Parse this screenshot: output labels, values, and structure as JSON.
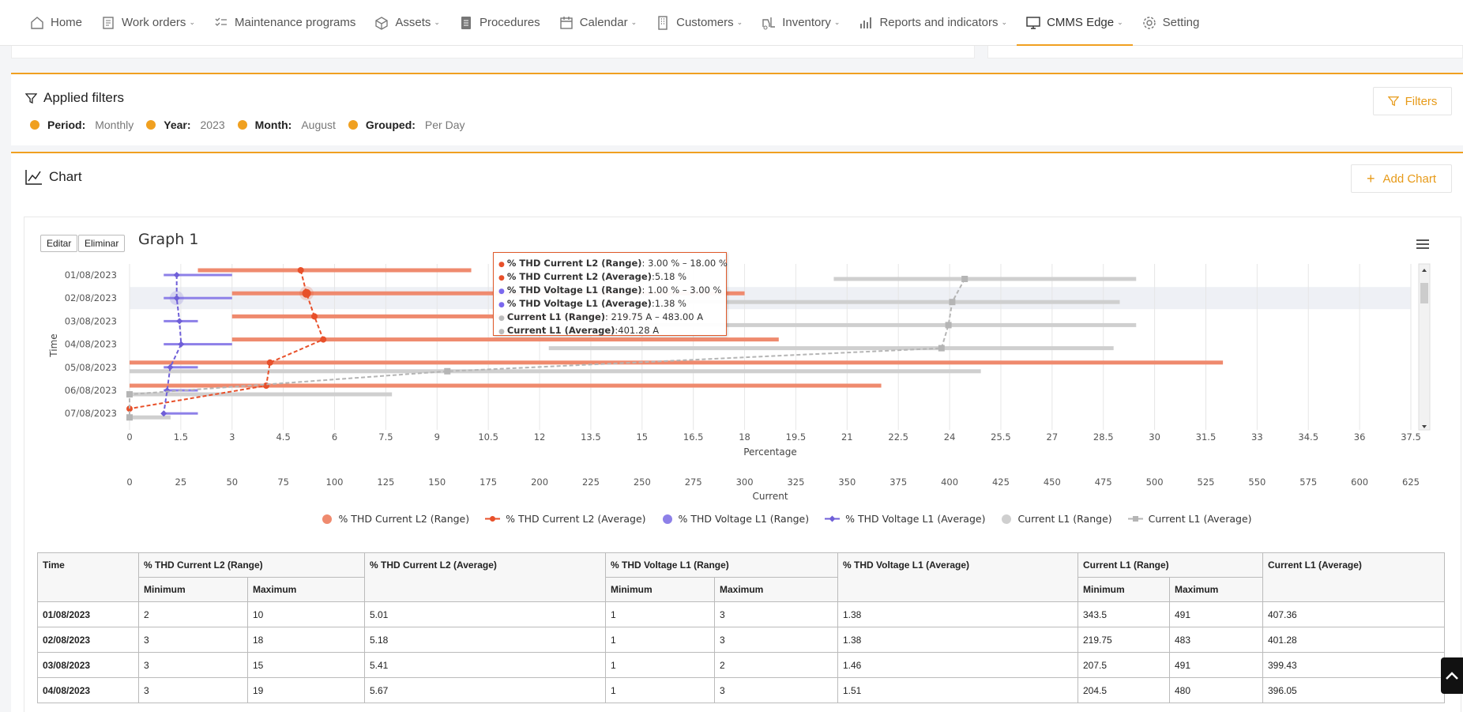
{
  "nav": {
    "items": [
      {
        "label": "Home",
        "icon": "home-icon",
        "chevron": false
      },
      {
        "label": "Work orders",
        "icon": "clipboard-icon",
        "chevron": true
      },
      {
        "label": "Maintenance programs",
        "icon": "checklist-icon",
        "chevron": false
      },
      {
        "label": "Assets",
        "icon": "cube-icon",
        "chevron": true
      },
      {
        "label": "Procedures",
        "icon": "document-icon",
        "chevron": false
      },
      {
        "label": "Calendar",
        "icon": "calendar-icon",
        "chevron": true
      },
      {
        "label": "Customers",
        "icon": "building-icon",
        "chevron": true
      },
      {
        "label": "Inventory",
        "icon": "forklift-icon",
        "chevron": true
      },
      {
        "label": "Reports and indicators",
        "icon": "bar-chart-icon",
        "chevron": true
      },
      {
        "label": "CMMS Edge",
        "icon": "monitor-icon",
        "chevron": true,
        "active": true
      },
      {
        "label": "Setting",
        "icon": "gear-icon",
        "chevron": false
      }
    ]
  },
  "filters": {
    "title": "Applied filters",
    "button": "Filters",
    "chips": [
      {
        "key": "Period:",
        "value": "Monthly"
      },
      {
        "key": "Year:",
        "value": "2023"
      },
      {
        "key": "Month:",
        "value": "August"
      },
      {
        "key": "Grouped:",
        "value": "Per Day"
      }
    ]
  },
  "chart_panel": {
    "title": "Chart",
    "add_button": "Add Chart",
    "edit_button": "Editar",
    "delete_button": "Eliminar",
    "graph_name": "Graph 1"
  },
  "tooltip": [
    {
      "label": "% THD Current L2 (Range)",
      "value": ": 3.00 % – 18.00 %",
      "color": "#e8502a"
    },
    {
      "label": "% THD Current L2 (Average)",
      "value": ":5.18 %",
      "color": "#e8502a"
    },
    {
      "label": "% THD Voltage L1 (Range)",
      "value": ": 1.00 % – 3.00 %",
      "color": "#7b68ee"
    },
    {
      "label": "% THD Voltage L1 (Average)",
      "value": ":1.38 %",
      "color": "#7b68ee"
    },
    {
      "label": "Current L1 (Range)",
      "value": ": 219.75 A – 483.00 A",
      "color": "#bbbbbb"
    },
    {
      "label": "Current L1 (Average)",
      "value": ":401.28 A",
      "color": "#bbbbbb"
    }
  ],
  "chart_data": {
    "type": "line",
    "ylabel": "Time",
    "xlabel": "Percentage",
    "x2label": "Current",
    "categories": [
      "01/08/2023",
      "02/08/2023",
      "03/08/2023",
      "04/08/2023",
      "05/08/2023",
      "06/08/2023",
      "07/08/2023"
    ],
    "x_ticks": [
      "0",
      "1.5",
      "3",
      "4.5",
      "6",
      "7.5",
      "9",
      "10.5",
      "12",
      "13.5",
      "15",
      "16.5",
      "18",
      "19.5",
      "21",
      "22.5",
      "24",
      "25.5",
      "27",
      "28.5",
      "30",
      "31.5",
      "33",
      "34.5",
      "36",
      "37.5"
    ],
    "x2_ticks": [
      "0",
      "25",
      "50",
      "75",
      "100",
      "125",
      "150",
      "175",
      "200",
      "225",
      "250",
      "275",
      "300",
      "325",
      "350",
      "375",
      "400",
      "425",
      "450",
      "475",
      "500",
      "525",
      "550",
      "575",
      "600",
      "625"
    ],
    "xlim": [
      0,
      37.5
    ],
    "x2lim": [
      0,
      625
    ],
    "series": [
      {
        "name": "% THD Current L2 (Range)",
        "color": "#ef8a6e",
        "axis": "pct",
        "kind": "range",
        "min": [
          2,
          3,
          3,
          3,
          0,
          0,
          null
        ],
        "max": [
          10,
          18,
          15,
          19,
          32,
          22,
          null
        ]
      },
      {
        "name": "% THD Current L2 (Average)",
        "color": "#e8502a",
        "axis": "pct",
        "kind": "avg",
        "values": [
          5.01,
          5.18,
          5.41,
          5.67,
          4.11,
          4.0,
          0
        ]
      },
      {
        "name": "% THD Voltage L1 (Range)",
        "color": "#8d80e8",
        "axis": "pct",
        "kind": "range",
        "min": [
          1,
          1,
          1,
          1,
          1,
          1,
          1
        ],
        "max": [
          3,
          3,
          2,
          3,
          2,
          2,
          2
        ]
      },
      {
        "name": "% THD Voltage L1 (Average)",
        "color": "#6f5fd8",
        "axis": "pct",
        "kind": "avg",
        "values": [
          1.38,
          1.38,
          1.46,
          1.51,
          1.19,
          1.1,
          1.0
        ]
      },
      {
        "name": "Current L1 (Range)",
        "color": "#cfcfcf",
        "axis": "cur",
        "kind": "range",
        "min": [
          343.5,
          219.75,
          207.5,
          204.5,
          0,
          0,
          0
        ],
        "max": [
          491,
          483,
          491,
          480,
          415.25,
          128,
          20
        ]
      },
      {
        "name": "Current L1 (Average)",
        "color": "#b5b5b5",
        "axis": "cur",
        "kind": "avg",
        "values": [
          407.36,
          401.28,
          399.43,
          396.05,
          155.0,
          0,
          0
        ]
      }
    ]
  },
  "table": {
    "headers": {
      "time": "Time",
      "g1": "% THD Current L2 (Range)",
      "g2": "% THD Current L2 (Average)",
      "g3": "% THD Voltage L1 (Range)",
      "g4": "% THD Voltage L1 (Average)",
      "g5": "Current L1 (Range)",
      "g6": "Current L1 (Average)",
      "min": "Minimum",
      "max": "Maximum"
    },
    "rows": [
      [
        "01/08/2023",
        "2",
        "10",
        "5.01",
        "1",
        "3",
        "1.38",
        "343.5",
        "491",
        "407.36"
      ],
      [
        "02/08/2023",
        "3",
        "18",
        "5.18",
        "1",
        "3",
        "1.38",
        "219.75",
        "483",
        "401.28"
      ],
      [
        "03/08/2023",
        "3",
        "15",
        "5.41",
        "1",
        "2",
        "1.46",
        "207.5",
        "491",
        "399.43"
      ],
      [
        "04/08/2023",
        "3",
        "19",
        "5.67",
        "1",
        "3",
        "1.51",
        "204.5",
        "480",
        "396.05"
      ]
    ]
  },
  "colors": {
    "accent": "#f0a020"
  }
}
